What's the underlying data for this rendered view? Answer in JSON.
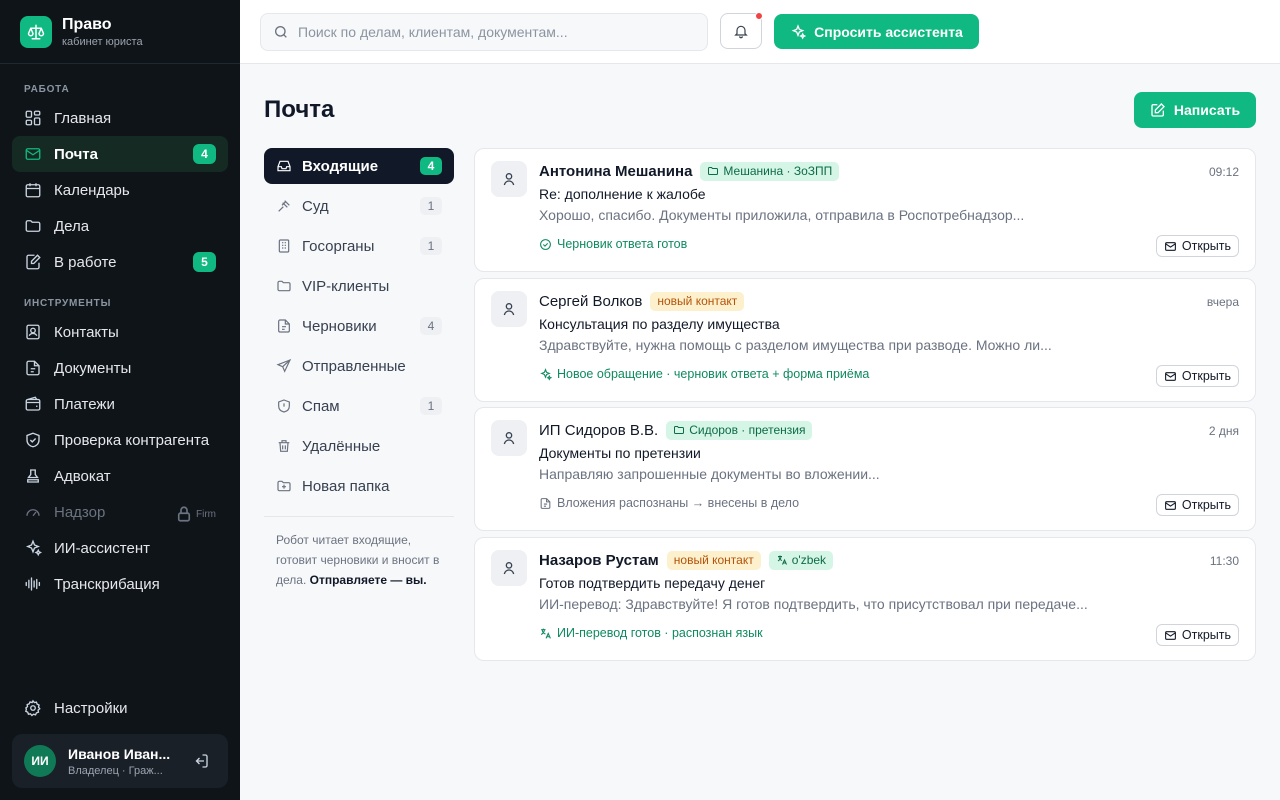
{
  "brand": {
    "title": "Право",
    "subtitle": "кабинет юриста"
  },
  "sidebar": {
    "section_work": "РАБОТА",
    "section_tools": "ИНСТРУМЕНТЫ",
    "items": [
      {
        "label": "Главная",
        "icon": "grid-icon"
      },
      {
        "label": "Почта",
        "icon": "mail-icon",
        "badge": "4",
        "active": true
      },
      {
        "label": "Календарь",
        "icon": "calendar-icon"
      },
      {
        "label": "Дела",
        "icon": "folder-icon"
      },
      {
        "label": "В работе",
        "icon": "edit-icon",
        "badge": "5"
      },
      {
        "label": "Контакты",
        "icon": "contacts-icon"
      },
      {
        "label": "Документы",
        "icon": "document-icon"
      },
      {
        "label": "Платежи",
        "icon": "wallet-icon"
      },
      {
        "label": "Проверка контрагента",
        "icon": "shield-check-icon"
      },
      {
        "label": "Адвокат",
        "icon": "stamp-icon"
      },
      {
        "label": "Надзор",
        "icon": "gauge-icon",
        "lock": "Firm"
      },
      {
        "label": "ИИ-ассистент",
        "icon": "sparkles-icon"
      },
      {
        "label": "Транскрибация",
        "icon": "audio-wave-icon"
      }
    ],
    "settings": "Настройки"
  },
  "user": {
    "initials": "ИИ",
    "name": "Иванов Иван...",
    "role": "Владелец · Граж..."
  },
  "topbar": {
    "search_placeholder": "Поиск по делам, клиентам, документам...",
    "ask_label": "Спросить ассистента"
  },
  "page": {
    "title": "Почта",
    "compose_label": "Написать"
  },
  "folders": [
    {
      "label": "Входящие",
      "count": "4",
      "icon": "inbox-icon",
      "active": true
    },
    {
      "label": "Суд",
      "count": "1",
      "icon": "gavel-icon"
    },
    {
      "label": "Госорганы",
      "count": "1",
      "icon": "building-icon"
    },
    {
      "label": "VIP-клиенты",
      "count": "",
      "icon": "folder-icon"
    },
    {
      "label": "Черновики",
      "count": "4",
      "icon": "file-icon"
    },
    {
      "label": "Отправленные",
      "count": "",
      "icon": "send-icon"
    },
    {
      "label": "Спам",
      "count": "1",
      "icon": "shield-icon"
    },
    {
      "label": "Удалённые",
      "count": "",
      "icon": "trash-icon"
    },
    {
      "label": "Новая папка",
      "count": "",
      "icon": "folder-plus-icon"
    }
  ],
  "folder_note": {
    "text": "Робот читает входящие, готовит черновики и вносит в дела.",
    "bold": "Отправляете — вы."
  },
  "messages": [
    {
      "sender": "Антонина Мешанина",
      "sender_bold": true,
      "tags": [
        {
          "label": "Мешанина · ЗоЗПП",
          "style": "green",
          "icon": "folder-icon"
        }
      ],
      "time": "09:12",
      "subject": "Re: дополнение к жалобе",
      "preview": "Хорошо, спасибо. Документы приложила, отправила в Роспотребнадзор...",
      "status": "Черновик ответа готов",
      "status_style": "green",
      "status_icon": "check-circle-icon",
      "open_label": "Открыть"
    },
    {
      "sender": "Сергей Волков",
      "sender_bold": false,
      "tags": [
        {
          "label": "новый контакт",
          "style": "orange",
          "icon": ""
        }
      ],
      "time": "вчера",
      "subject": "Консультация по разделу имущества",
      "preview": "Здравствуйте, нужна помощь с разделом имущества при разводе. Можно ли...",
      "status": "Новое обращение · черновик ответа + форма приёма",
      "status_style": "green",
      "status_icon": "sparkles-icon",
      "open_label": "Открыть"
    },
    {
      "sender": "ИП Сидоров В.В.",
      "sender_bold": false,
      "tags": [
        {
          "label": "Сидоров · претензия",
          "style": "green",
          "icon": "folder-icon"
        }
      ],
      "time": "2 дня",
      "subject": "Документы по претензии",
      "preview": "Направляю запрошенные документы во вложении...",
      "status": "Вложения распознаны → внесены в дело",
      "status_style": "gray",
      "status_icon": "file-icon",
      "open_label": "Открыть"
    },
    {
      "sender": "Назаров Рустам",
      "sender_bold": true,
      "tags": [
        {
          "label": "новый контакт",
          "style": "orange",
          "icon": ""
        },
        {
          "label": "o'zbek",
          "style": "green",
          "icon": "translate-icon"
        }
      ],
      "time": "11:30",
      "subject": "Готов подтвердить передачу денег",
      "preview": "ИИ-перевод: Здравствуйте! Я готов подтвердить, что присутствовал при передаче...",
      "status": "ИИ-перевод готов · распознан язык",
      "status_style": "green",
      "status_icon": "translate-icon",
      "open_label": "Открыть"
    }
  ],
  "colors": {
    "accent": "#10b981",
    "sidebar_bg": "#0f1419",
    "notification_dot": "#ef4444"
  }
}
